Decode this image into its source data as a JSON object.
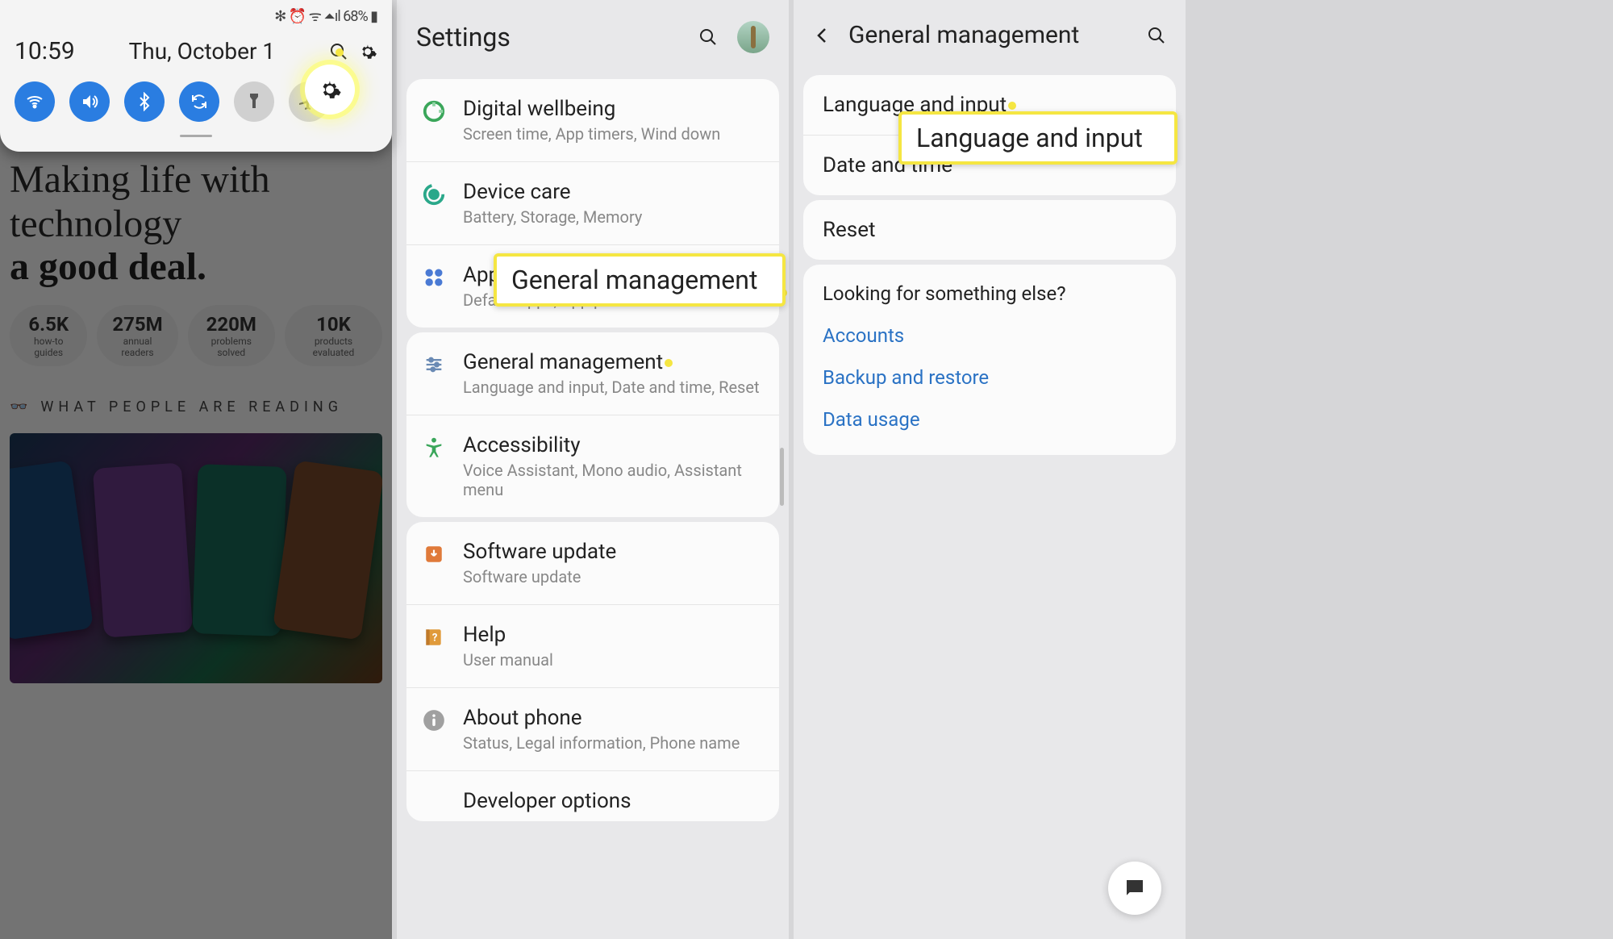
{
  "panel1": {
    "status_icons": "✻ ⏰ ᯤ ⏶ıl 68% ▮",
    "time": "10:59",
    "date": "Thu, October 1",
    "bg": {
      "headline1": "Making life with technology",
      "headline2": "a good deal.",
      "stats": [
        {
          "num": "6.5K",
          "lab": "how-to guides"
        },
        {
          "num": "275M",
          "lab": "annual readers"
        },
        {
          "num": "220M",
          "lab": "problems solved"
        },
        {
          "num": "10K",
          "lab": "products evaluated"
        }
      ],
      "reading_head": "WHAT PEOPLE ARE READING"
    }
  },
  "panel2": {
    "title": "Settings",
    "groups": [
      {
        "rows": [
          {
            "icon": "wellbeing",
            "t": "Digital wellbeing",
            "s": "Screen time, App timers, Wind down"
          },
          {
            "icon": "devicecare",
            "t": "Device care",
            "s": "Battery, Storage, Memory"
          },
          {
            "icon": "apps",
            "t": "Apps",
            "s": "Default apps, App permissions"
          }
        ]
      },
      {
        "rows": [
          {
            "icon": "general",
            "t": "General management",
            "s": "Language and input, Date and time, Reset",
            "dot": true
          },
          {
            "icon": "accessibility",
            "t": "Accessibility",
            "s": "Voice Assistant, Mono audio, Assistant menu"
          }
        ]
      },
      {
        "rows": [
          {
            "icon": "update",
            "t": "Software update",
            "s": "Software update"
          },
          {
            "icon": "help",
            "t": "Help",
            "s": "User manual"
          },
          {
            "icon": "about",
            "t": "About phone",
            "s": "Status, Legal information, Phone name"
          },
          {
            "icon": "dev",
            "t": "Developer options",
            "s": ""
          }
        ]
      }
    ],
    "callout": "General management"
  },
  "panel3": {
    "title": "General management",
    "group1": [
      {
        "t": "Language and input",
        "dot": true
      },
      {
        "t": "Date and time"
      }
    ],
    "group2": [
      {
        "t": "Reset"
      }
    ],
    "looking": "Looking for something else?",
    "links": [
      "Accounts",
      "Backup and restore",
      "Data usage"
    ],
    "callout": "Language and input"
  }
}
